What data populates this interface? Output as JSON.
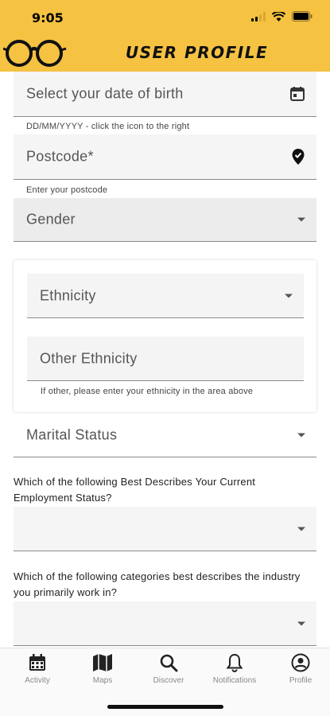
{
  "status_bar": {
    "time": "9:05"
  },
  "header": {
    "title": "USER PROFILE",
    "logo_icon": "glasses-icon"
  },
  "fields": {
    "dob": {
      "label": "Select your date of birth",
      "helper": "DD/MM/YYYY - click the icon to the right",
      "icon": "calendar-icon"
    },
    "postcode": {
      "label": "Postcode*",
      "helper": "Enter your postcode",
      "icon": "location-pin-icon"
    },
    "gender": {
      "label": "Gender"
    },
    "ethnicity": {
      "label": "Ethnicity"
    },
    "other_ethnicity": {
      "label": "Other Ethnicity",
      "helper": "If other, please enter your ethnicity in the area above"
    },
    "marital_status": {
      "label": "Marital Status"
    },
    "employment": {
      "question": "Which of the following Best Describes Your Current Employment Status?",
      "value": ""
    },
    "industry": {
      "question": "Which of the following categories best describes the industry you primarily work in?",
      "value": ""
    }
  },
  "bottom_nav": {
    "items": [
      {
        "label": "Activity",
        "icon": "calendar-grid-icon"
      },
      {
        "label": "Maps",
        "icon": "map-icon"
      },
      {
        "label": "Discover",
        "icon": "search-icon"
      },
      {
        "label": "Notifications",
        "icon": "bell-icon"
      },
      {
        "label": "Profile",
        "icon": "account-circle-icon"
      }
    ]
  },
  "colors": {
    "header_bg": "#F5C242",
    "field_bg": "#f5f5f5",
    "nav_label": "#8a8a8a"
  }
}
